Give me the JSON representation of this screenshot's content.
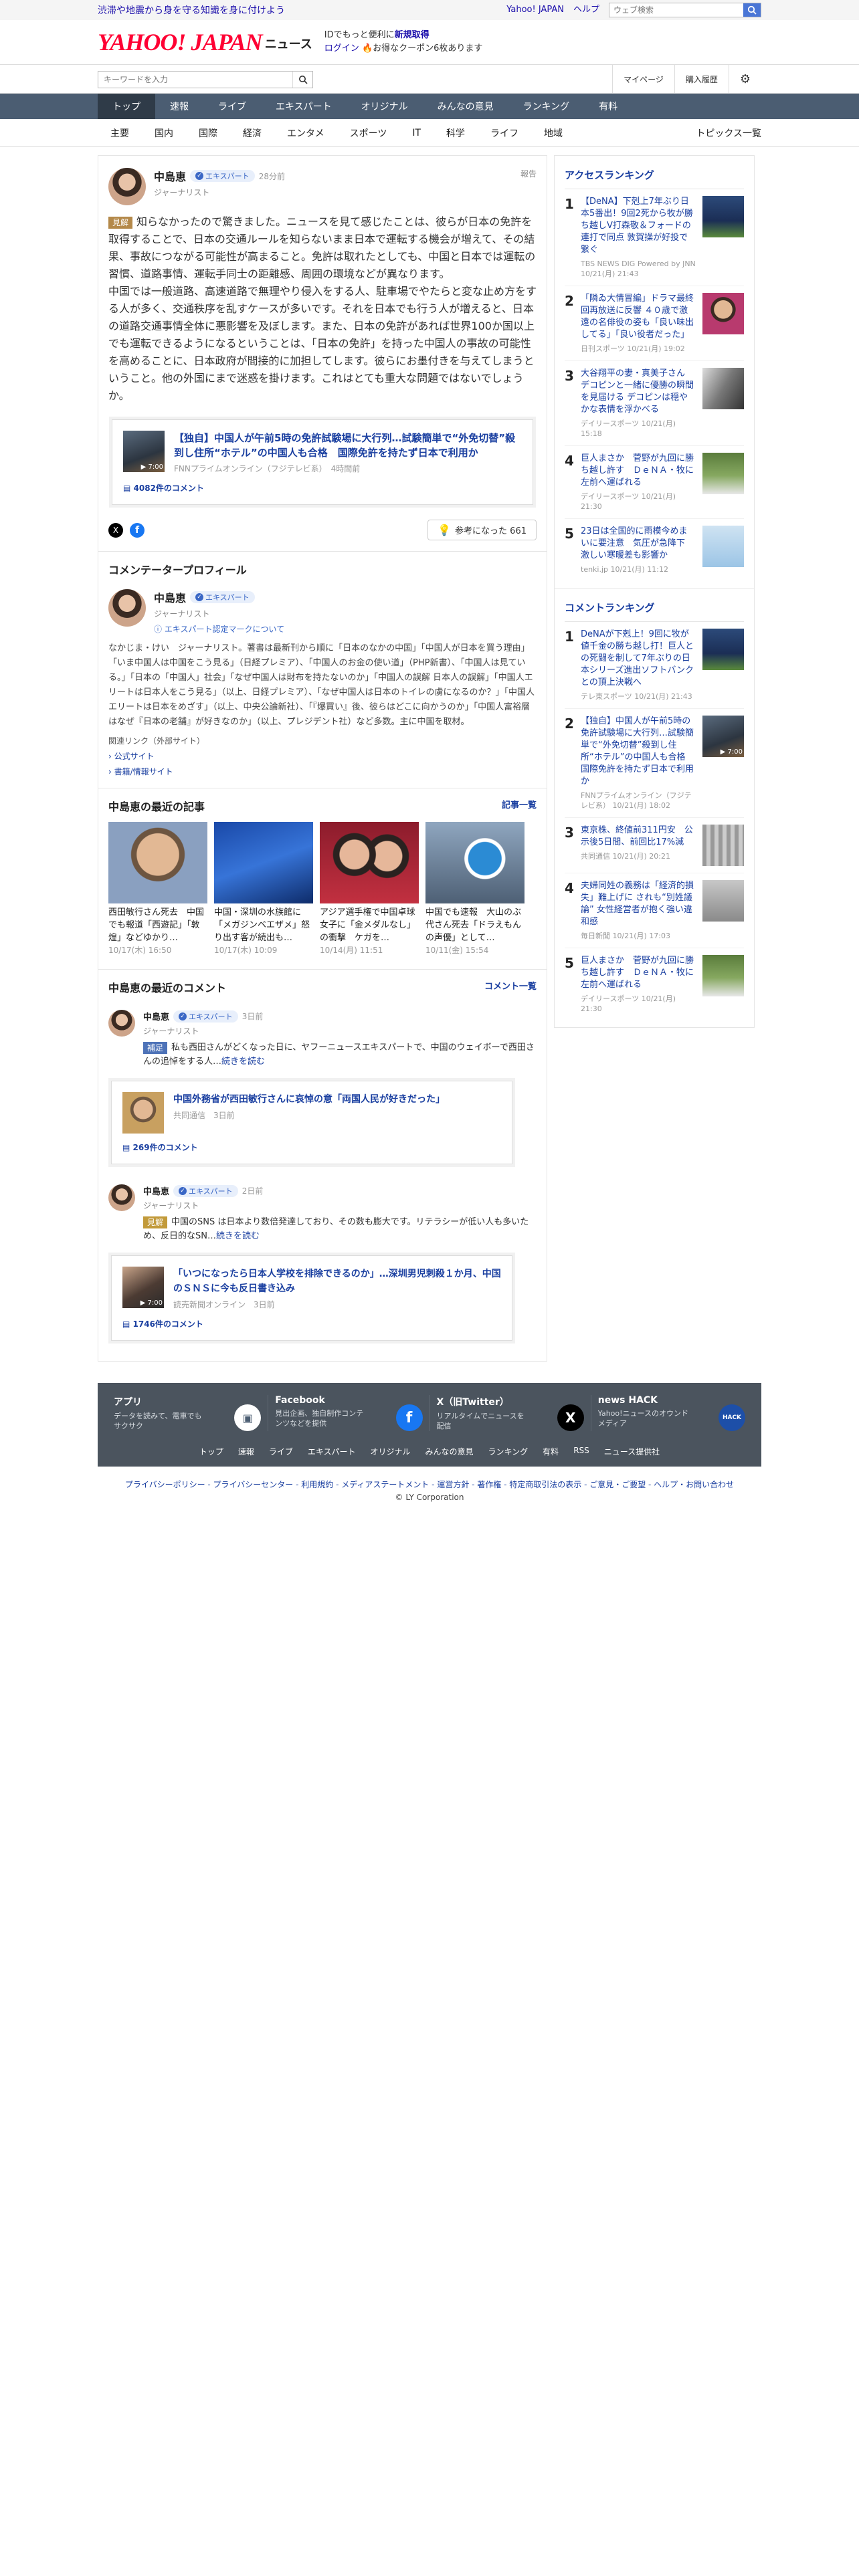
{
  "topbar": {
    "promo": "渋滞や地震から身を守る知識を身に付けよう",
    "yahoo_japan": "Yahoo! JAPAN",
    "help": "ヘルプ",
    "search_placeholder": "ウェブ検索"
  },
  "brand": {
    "logo": "YAHOO! JAPAN",
    "news": "ニュース",
    "copy_line1_pre": "IDでもっと便利に",
    "copy_line1_bold": "新規取得",
    "copy_line2_login": "ログイン",
    "copy_line2_coupon": "お得なクーポン6枚あります"
  },
  "keyword": {
    "placeholder": "キーワードを入力"
  },
  "header_links": {
    "mypage": "マイページ",
    "history": "購入履歴"
  },
  "gnav": [
    "トップ",
    "速報",
    "ライブ",
    "エキスパート",
    "オリジナル",
    "みんなの意見",
    "ランキング",
    "有料"
  ],
  "snav": [
    "主要",
    "国内",
    "国際",
    "経済",
    "エンタメ",
    "スポーツ",
    "IT",
    "科学",
    "ライフ",
    "地域"
  ],
  "snav_right": "トピックス一覧",
  "author": {
    "name": "中島恵",
    "badge": "エキスパート",
    "time": "28分前",
    "role": "ジャーナリスト",
    "report": "報告"
  },
  "comment": {
    "tag": "見解",
    "body": "知らなかったので驚きました。ニュースを見て感じたことは、彼らが日本の免許を取得することで、日本の交通ルールを知らないまま日本で運転する機会が増えて、その結果、事故につながる可能性が高まること。免許は取れたとしても、中国と日本では運転の習慣、道路事情、運転手同士の距離感、周囲の環境などが異なります。\n中国では一般道路、高速道路で無理やり侵入をする人、駐車場でやたらと変な止め方をする人が多く、交通秩序を乱すケースが多いです。それを日本でも行う人が増えると、日本の道路交通事情全体に悪影響を及ぼします。また、日本の免許があれば世界100か国以上でも運転できるようになるということは、「日本の免許」を持った中国人の事故の可能性を高めることに、日本政府が間接的に加担してします。彼らにお墨付きを与えてしまうということ。他の外国にまで迷惑を掛けます。これはとても重大な問題ではないでしょうか。"
  },
  "article": {
    "title": "【独自】中国人が午前5時の免許試験場に大行列…試験簡単で“外免切替”殺到し住所“ホテル”の中国人も合格　国際免許を持たず日本で利用か",
    "source": "FNNプライムオンライン（フジテレビ系）",
    "time": "4時間前",
    "comments": "4082件のコメント",
    "duration": "7:00"
  },
  "share": {
    "x": "X",
    "fb": "f",
    "useful": "参考になった 661"
  },
  "profile": {
    "heading": "コメンテータープロフィール",
    "name": "中島恵",
    "badge": "エキスパート",
    "role": "ジャーナリスト",
    "link": "エキスパート認定マークについて",
    "body": "なかじま・けい　ジャーナリスト。著書は最新刊から順に「日本のなかの中国」「中国人が日本を買う理由」「いま中国人は中国をこう見る」（日経プレミア）、「中国人のお金の使い道」（PHP新書）、「中国人は見ている。」「日本の「中国人」社会」「なぜ中国人は財布を持たないのか」「中国人の誤解 日本人の誤解」「中国人エリートは日本人をこう見る」（以上、日経プレミア）、「なぜ中国人は日本のトイレの虜になるのか？」「中国人エリートは日本をめざす」（以上、中央公論新社）、「『爆買い』後、彼らはどこに向かうのか」「中国人富裕層はなぜ『日本の老舗』が好きなのか」（以上、プレジデント社）など多数。主に中国を取材。",
    "ext": "関連リンク（外部サイト）",
    "links": [
      "公式サイト",
      "書籍/情報サイト"
    ]
  },
  "articles": {
    "heading": "中島恵の最近の記事",
    "more": "記事一覧",
    "items": [
      {
        "title": "西田敏行さん死去　中国でも報道「西遊記」「敦煌」などゆかり…",
        "date": "10/17(木) 16:50"
      },
      {
        "title": "中国・深圳の水族館に「メガジンベエザメ」怒り出す客が続出も…",
        "date": "10/17(木) 10:09"
      },
      {
        "title": "アジア選手権で中国卓球女子に「金メダルなし」の衝撃　ケガを…",
        "date": "10/14(月) 11:51"
      },
      {
        "title": "中国でも速報　大山のぶ代さん死去「ドラえもんの声優」として…",
        "date": "10/11(金) 15:54"
      }
    ]
  },
  "comments": {
    "heading": "中島恵の最近のコメント",
    "more": "コメント一覧",
    "items": [
      {
        "name": "中島恵",
        "badge": "エキスパート",
        "time": "3日前",
        "role": "ジャーナリスト",
        "tag": "補足",
        "text": "私も西田さんがどくなった日に、ヤフーニュースエキスパートで、中国のウェイボーで西田さんの追悼をする人…",
        "more": "続きを読む",
        "card_title": "中国外務省が西田敏行さんに哀悼の意「両国人民が好きだった」",
        "card_src": "共同通信",
        "card_time": "3日前",
        "card_comments": "269件のコメント"
      },
      {
        "name": "中島恵",
        "badge": "エキスパート",
        "time": "2日前",
        "role": "ジャーナリスト",
        "tag": "見解",
        "text": "中国のSNS は日本より数倍発達しており、その数も膨大です。リテラシーが低い人も多いため、反日的なSN…",
        "more": "続きを読む",
        "card_title": "「いつになったら日本人学校を排除できるのか」…深圳男児刺殺１か月、中国のＳＮＳに今も反日書き込み",
        "card_src": "読売新聞オンライン",
        "card_time": "3日前",
        "card_comments": "1746件のコメント",
        "duration": "7:00"
      }
    ]
  },
  "access_ranking": {
    "heading": "アクセスランキング",
    "items": [
      {
        "title": "【DeNA】下剋上7年ぶり日本5番出！9回2死から牧が勝ち越しV打森敬＆フォードの連打で同点 敦賀操が好投で繋ぐ",
        "src": "TBS NEWS DIG Powered by JNN",
        "date": "10/21(月) 21:43"
      },
      {
        "title": "「隣ゐ大情冒編」ドラマ最終回再放送に反響 ４０歳で激遠の名俳役の姿も「良い味出してる」「良い役者だった」",
        "src": "日刊スポーツ",
        "date": "10/21(月) 19:02"
      },
      {
        "title": "大谷翔平の妻・真美子さん デコピンと一緒に優勝の瞬間を見届ける デコピンは穏やかな表情を浮かべる",
        "src": "デイリースポーツ",
        "date": "10/21(月) 15:18"
      },
      {
        "title": "巨人まさか　菅野が九回に勝ち越し許す　ＤｅＮＡ・牧に左前へ運ばれる",
        "src": "デイリースポーツ",
        "date": "10/21(月) 21:30"
      },
      {
        "title": "23日は全国的に雨模今めまいに要注意　気圧が急降下　激しい寒暖差も影響か",
        "src": "tenki.jp",
        "date": "10/21(月) 11:12"
      }
    ]
  },
  "comment_ranking": {
    "heading": "コメントランキング",
    "items": [
      {
        "title": "DeNAが下剋上！9回に牧が値千金の勝ち越し打！巨人との死闘を制して7年ぶりの日本シリーズ進出ソフトバンクとの頂上決戦へ",
        "src": "テレ東スポーツ",
        "date": "10/21(月) 21:43"
      },
      {
        "title": "【独自】中国人が午前5時の免許試験場に大行列…試験簡単で“外免切替”殺到し住所“ホテル”の中国人も合格　国際免許を持たず日本で利用か",
        "src": "FNNプライムオンライン（フジテレビ系）",
        "date": "10/21(月) 18:02",
        "duration": "7:00"
      },
      {
        "title": "東京株、終値前311円安　公示後5日間、前回比17%減",
        "src": "共同通信",
        "date": "10/21(月) 20:21"
      },
      {
        "title": "夫婦同姓の義務は「経済的損失」難上げに されも“別姓議論” 女性経営者が抱く強い違和感",
        "src": "毎日新聞",
        "date": "10/21(月) 17:03"
      },
      {
        "title": "巨人まさか　菅野が九回に勝ち越し許す　ＤｅＮＡ・牧に左前へ運ばれる",
        "src": "デイリースポーツ",
        "date": "10/21(月) 21:30"
      }
    ]
  },
  "footer": {
    "apps": [
      {
        "title": "アプリ",
        "sub": "データを読みて、電車でもサクサク"
      },
      {
        "title": "Facebook",
        "sub": "見出企画、独自制作コンテンツなどを提供"
      },
      {
        "title": "X（旧Twitter）",
        "sub": "リアルタイムでニュースを配信"
      },
      {
        "title": "news HACK",
        "sub": "Yahoo!ニュースのオウンドメディア"
      }
    ],
    "nav": [
      "トップ",
      "速報",
      "ライブ",
      "エキスパート",
      "オリジナル",
      "みんなの意見",
      "ランキング",
      "有料",
      "RSS",
      "ニュース提供社"
    ],
    "legal": "プライバシーポリシー - プライバシーセンター - 利用規約 - メディアステートメント - 運営方針 - 著作権 - 特定商取引法の表示 - ご意見・ご要望 - ヘルプ・お問い合わせ",
    "copyright": "© LY Corporation"
  }
}
